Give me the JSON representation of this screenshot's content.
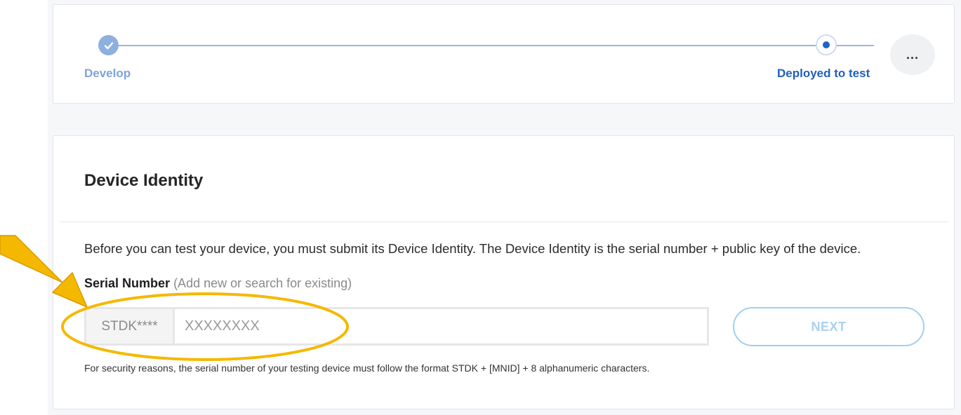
{
  "stepper": {
    "steps": [
      {
        "label": "Develop",
        "state": "completed"
      },
      {
        "label": "Deployed to test",
        "state": "current"
      }
    ],
    "more_label": "...",
    "more_icon": "ellipsis-icon",
    "done_icon": "checkmark-icon"
  },
  "device_identity": {
    "title": "Device Identity",
    "description": "Before you can test your device, you must submit its Device Identity. The Device Identity is the serial number + public key of the device.",
    "serial_label": "Serial Number",
    "serial_hint": "(Add new or search for existing)",
    "serial_prefix": "STDK****",
    "serial_placeholder": "XXXXXXXX",
    "serial_value": "",
    "next_label": "NEXT",
    "footnote": "For security reasons, the serial number of your testing device must follow the format STDK + [MNID] + 8 alphanumeric characters."
  },
  "colors": {
    "accent": "#1f5fbf",
    "completed": "#8eb0e0",
    "next_border": "#9fd0f0",
    "annotation": "#f5b800"
  }
}
